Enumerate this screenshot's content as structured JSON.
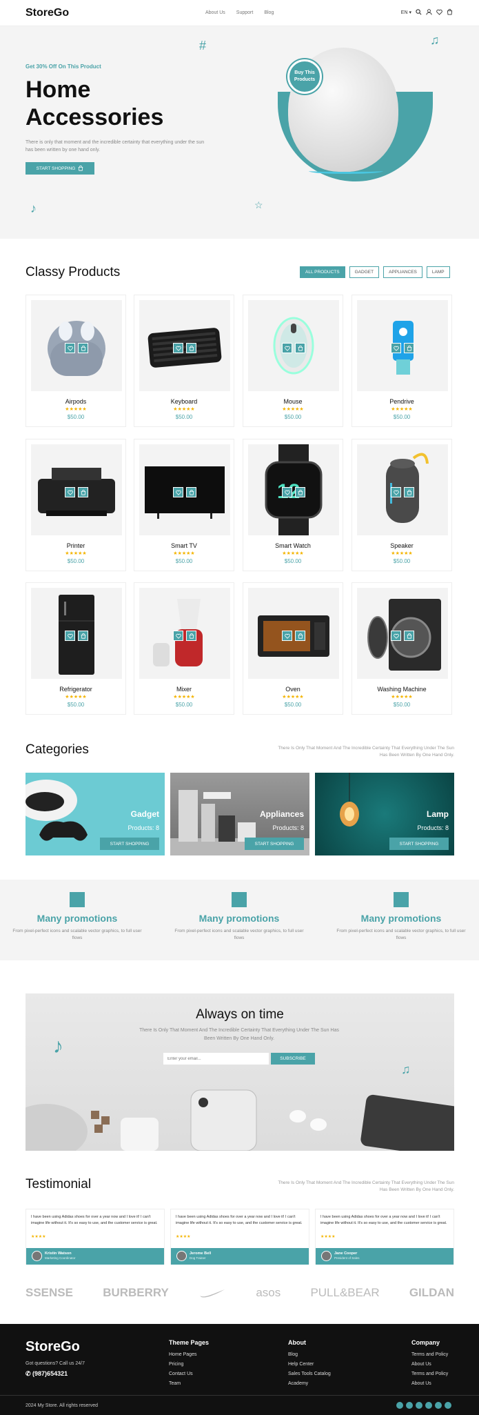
{
  "header": {
    "logo": "StoreGo",
    "nav": [
      "About Us",
      "Support",
      "Blog"
    ],
    "lang": "EN"
  },
  "hero": {
    "subtitle": "Get 30% Off On This Product",
    "title": "Home Accessories",
    "description": "There is only that moment and the incredible certainty that everything under the sun has been written by one hand only.",
    "button": "START SHOPPING",
    "badge": "Buy This Products"
  },
  "products": {
    "title": "Classy Products",
    "filters": [
      "ALL PRODUCTS",
      "GADGET",
      "APPLIANCES",
      "LAMP"
    ],
    "active_filter": "ALL PRODUCTS",
    "items": [
      {
        "name": "Airpods",
        "stars": "★★★★★",
        "price": "$50.00",
        "icon": "earbuds-image"
      },
      {
        "name": "Keyboard",
        "stars": "★★★★★",
        "price": "$50.00",
        "icon": "keyboard-image"
      },
      {
        "name": "Mouse",
        "stars": "★★★★★",
        "price": "$50.00",
        "icon": "mouse-image"
      },
      {
        "name": "Pendrive",
        "stars": "★★★★★",
        "price": "$50.00",
        "icon": "usb-drive-image"
      },
      {
        "name": "Printer",
        "stars": "★★★★★",
        "price": "$50.00",
        "icon": "printer-image"
      },
      {
        "name": "Smart TV",
        "stars": "★★★★★",
        "price": "$50.00",
        "icon": "tv-image"
      },
      {
        "name": "Smart Watch",
        "stars": "★★★★★",
        "price": "$50.00",
        "icon": "watch-image"
      },
      {
        "name": "Speaker",
        "stars": "★★★★★",
        "price": "$50.00",
        "icon": "speaker-image"
      },
      {
        "name": "Refrigerator",
        "stars": "★★★★★",
        "price": "$50.00",
        "icon": "fridge-image"
      },
      {
        "name": "Mixer",
        "stars": "★★★★★",
        "price": "$50.00",
        "icon": "mixer-image"
      },
      {
        "name": "Oven",
        "stars": "★★★★★",
        "price": "$50.00",
        "icon": "oven-image"
      },
      {
        "name": "Washing  Machine",
        "stars": "★★★★★",
        "price": "$50.00",
        "icon": "washer-image"
      }
    ]
  },
  "categories": {
    "title": "Categories",
    "description": "There Is Only That Moment And The Incredible Certainty That Everything Under The Sun Has Been Written By One Hand Only.",
    "items": [
      {
        "name": "Gadget",
        "count": "Products: 8",
        "button": "START SHOPPING",
        "bg": "#6ccbd3"
      },
      {
        "name": "Appliances",
        "count": "Products: 8",
        "button": "START SHOPPING",
        "bg": "#8c8c8c"
      },
      {
        "name": "Lamp",
        "count": "Products: 8",
        "button": "START SHOPPING",
        "bg": "#0f5c5c"
      }
    ]
  },
  "promotions": [
    {
      "title": "Many promotions",
      "desc": "From pixel-perfect icons and scalable vector graphics, to full user flows",
      "icon": "tag-icon"
    },
    {
      "title": "Many promotions",
      "desc": "From pixel-perfect icons and scalable vector graphics, to full user flows",
      "icon": "store-icon"
    },
    {
      "title": "Many promotions",
      "desc": "From pixel-perfect icons and scalable vector graphics, to full user flows",
      "icon": "discount-icon"
    }
  ],
  "newsletter": {
    "title": "Always on time",
    "description": "There Is Only That Moment And The Incredible Certainty That Everything Under The Sun Has Been Written By One Hand Only.",
    "placeholder": "Enter your email...",
    "button": "SUBSCRIBE"
  },
  "testimonials": {
    "title": "Testimonial",
    "description": "There Is Only That Moment And The Incredible Certainty That Everything Under The Sun Has Been Written By One Hand Only.",
    "items": [
      {
        "text": "I have been using Adidas shoes for over a year now and I love it! I can't imagine life without it. It's so easy to use, and the customer service is great.",
        "stars": "★★★★",
        "name": "Kristin Watson",
        "role": "Marketing Coordinator"
      },
      {
        "text": "I have been using Adidas shoes for over a year now and I love it! I can't imagine life without it. It's so easy to use, and the customer service is great.",
        "stars": "★★★★",
        "name": "Jerome Bell",
        "role": "Dog Trainer"
      },
      {
        "text": "I have been using Adidas shoes for over a year now and I love it! I can't imagine life without it. It's so easy to use, and the customer service is great.",
        "stars": "★★★★",
        "name": "Jane Cooper",
        "role": "President of Sales"
      }
    ]
  },
  "brands": [
    "SSENSE",
    "BURBERRY",
    "NIKE",
    "asos",
    "PULL&BEAR",
    "GILDAN"
  ],
  "footer": {
    "logo": "StoreGo",
    "question": "Got questions? Call us 24/7",
    "phone": "(987)654321",
    "columns": [
      {
        "heading": "Theme Pages",
        "links": [
          "Home Pages",
          "Pricing",
          "Contact Us",
          "Team"
        ]
      },
      {
        "heading": "About",
        "links": [
          "Blog",
          "Help Center",
          "Sales Tools Catalog",
          "Academy"
        ]
      },
      {
        "heading": "Company",
        "links": [
          "Terms and Policy",
          "About Us",
          "Terms and Policy",
          "About Us"
        ]
      }
    ],
    "copyright": "2024 My Store. All rights reserved",
    "socials": [
      "facebook-icon",
      "twitter-icon",
      "instagram-icon",
      "linkedin-icon",
      "youtube-icon",
      "pinterest-icon"
    ]
  },
  "colors": {
    "accent": "#4aa3a8",
    "star": "#f4b400",
    "footer": "#111111"
  }
}
